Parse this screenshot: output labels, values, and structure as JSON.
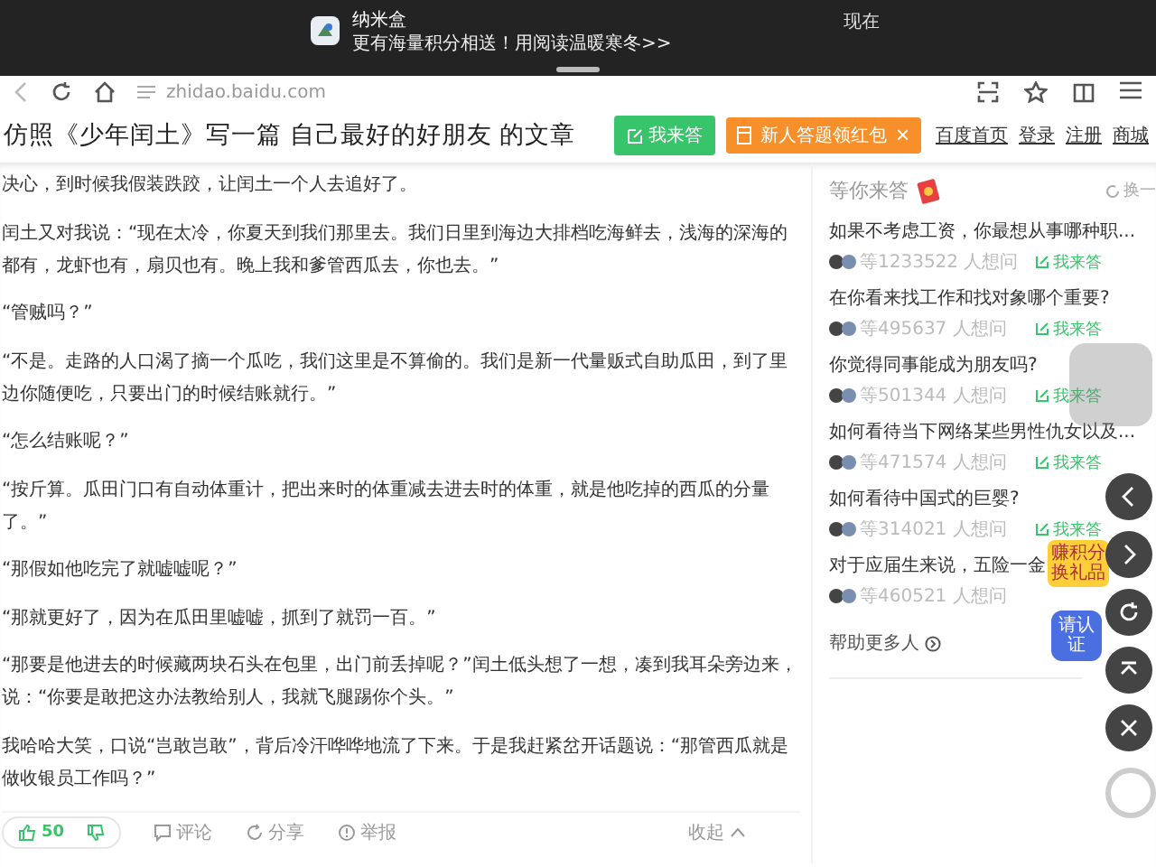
{
  "notification": {
    "app": "纳米盒",
    "message": "更有海量积分相送！用阅读温暖寒冬>>",
    "time": "现在"
  },
  "browser": {
    "url": "zhidao.baidu.com"
  },
  "header": {
    "title": "仿照《少年闰土》写一篇 自己最好的好朋友 的文章",
    "answer_button": "我来答",
    "promo": "新人答题领红包",
    "promo_close": "×",
    "links": [
      "百度首页",
      "登录",
      "注册",
      "商城"
    ]
  },
  "article": {
    "paragraphs": [
      "决心，到时候我假装跌跤，让闰土一个人去追好了。",
      "闰土又对我说：“现在太冷，你夏天到我们那里去。我们日里到海边大排档吃海鲜去，浅海的深海的都有，龙虾也有，扇贝也有。晚上我和爹管西瓜去，你也去。”",
      "“管贼吗？”",
      "“不是。走路的人口渴了摘一个瓜吃，我们这里是不算偷的。我们是新一代量贩式自助瓜田，到了里边你随便吃，只要出门的时候结账就行。”",
      "“怎么结账呢？”",
      "“按斤算。瓜田门口有自动体重计，把出来时的体重减去进去时的体重，就是他吃掉的西瓜的分量了。”",
      "“那假如他吃完了就嘘嘘呢？”",
      "“那就更好了，因为在瓜田里嘘嘘，抓到了就罚一百。”",
      "“那要是他进去的时候藏两块石头在包里，出门前丢掉呢？”闰土低头想了一想，凑到我耳朵旁边来，说：“你要是敢把这办法教给别人，我就飞腿踢你个头。”",
      "我哈哈大笑，口说“岂敢岂敢”，背后冷汗哗哗地流了下来。于是我赶紧岔开话题说：“那管西瓜就是做收银员工作吗？”"
    ]
  },
  "actions": {
    "likes": "50",
    "comment": "评论",
    "share": "分享",
    "report": "举报",
    "collapse": "收起"
  },
  "sidebar": {
    "title": "等你来答",
    "refresh": "换一",
    "more": "帮助更多人",
    "questions": [
      {
        "title": "如果不考虑工资，你最想从事哪种职...",
        "askers": "等1233522 人想问",
        "answer": "我来答"
      },
      {
        "title": "在你看来找工作和找对象哪个重要?",
        "askers": "等495637 人想问",
        "answer": "我来答"
      },
      {
        "title": "你觉得同事能成为朋友吗?",
        "askers": "等501344 人想问",
        "answer": "我来答"
      },
      {
        "title": "如何看待当下网络某些男性仇女以及...",
        "askers": "等471574 人想问",
        "answer": "我来答"
      },
      {
        "title": "如何看待中国式的巨婴?",
        "askers": "等314021 人想问",
        "answer": "我来答"
      },
      {
        "title": "对于应届生来说，五险一金",
        "askers": "等460521 人想问"
      }
    ]
  },
  "floating": {
    "points_badge": "赚积分换礼品",
    "verify_badge": "请认证"
  }
}
